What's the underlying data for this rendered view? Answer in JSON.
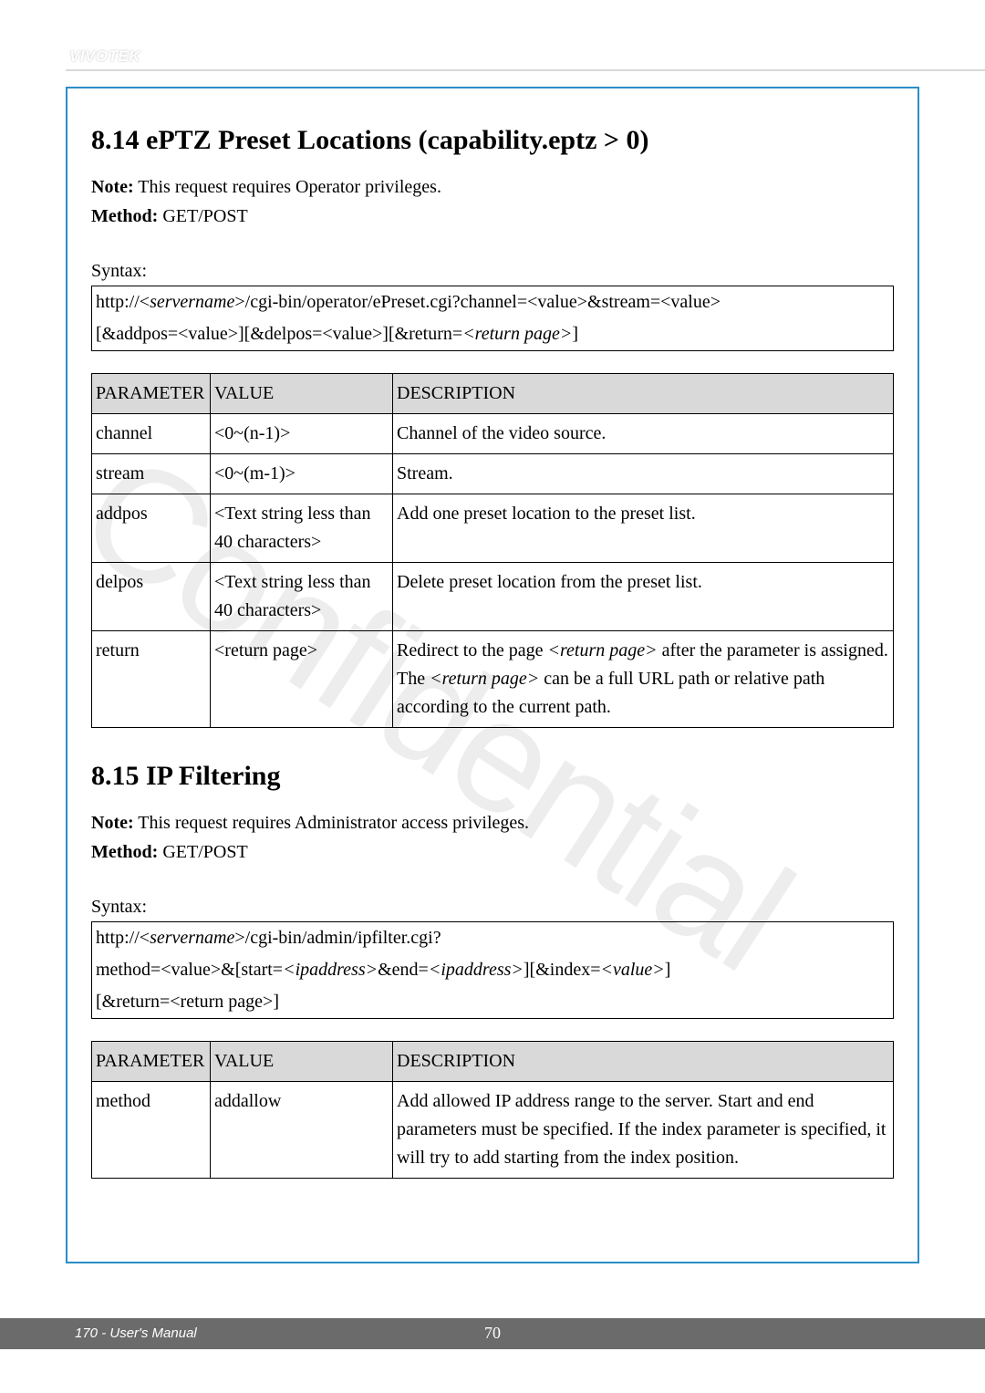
{
  "brand": "VIVOTEK",
  "watermark": "Confidential",
  "sections": {
    "s1": {
      "title": "8.14 ePTZ Preset Locations (capability.eptz > 0)",
      "note_label": "Note:",
      "note_text": " This request requires Operator privileges.",
      "method_label": "Method:",
      "method_text": " GET/POST",
      "syntax_label": "Syntax:",
      "syntax_l1_a": "http://<",
      "syntax_l1_b": "servername",
      "syntax_l1_c": ">/cgi-bin/operator/ePreset.cgi?channel=<value>&stream=<value>",
      "syntax_l2_a": "[&addpos=<value>][&delpos=<value>][&return=",
      "syntax_l2_b": "<return page>",
      "syntax_l2_c": "]",
      "headers": {
        "p": "PARAMETER",
        "v": "VALUE",
        "d": "DESCRIPTION"
      },
      "rows": [
        {
          "p": "channel",
          "v": "<0~(n-1)>",
          "d": "Channel of the video source."
        },
        {
          "p": "stream",
          "v": "<0~(m-1)>",
          "d": "Stream."
        },
        {
          "p": "addpos",
          "v": "<Text string less than 40 characters>",
          "d": "Add one preset location to the preset list."
        },
        {
          "p": "delpos",
          "v": "<Text string less than 40 characters>",
          "d": "Delete preset location from the preset list."
        },
        {
          "p": "return",
          "v": "<return page>",
          "d_a": "Redirect to the page ",
          "d_b": "<return page>",
          "d_c": " after the parameter is assigned. The ",
          "d_d": "<return page>",
          "d_e": " can be a full URL path or relative path according to the current path."
        }
      ]
    },
    "s2": {
      "title": "8.15 IP Filtering",
      "note_label": "Note:",
      "note_text": " This request requires Administrator access privileges.",
      "method_label": "Method:",
      "method_text": " GET/POST",
      "syntax_label": "Syntax:",
      "syntax_l1_a": "http://<",
      "syntax_l1_b": "servername",
      "syntax_l1_c": ">/cgi-bin/admin/ipfilter.cgi?",
      "syntax_l2_a": "method=<value>&[start=",
      "syntax_l2_b": "<ipaddress>",
      "syntax_l2_c": "&end=",
      "syntax_l2_d": "<ipaddress>",
      "syntax_l2_e": "][&index=",
      "syntax_l2_f": "<value>",
      "syntax_l2_g": "]",
      "syntax_l3": "[&return=<return page>]",
      "headers": {
        "p": "PARAMETER",
        "v": "VALUE",
        "d": "DESCRIPTION"
      },
      "rows": [
        {
          "p": "method",
          "v": "addallow",
          "d": "Add allowed IP address range to the server. Start and end parameters must be specified. If the index parameter is specified, it will try to add starting from the index position."
        }
      ]
    }
  },
  "footer": {
    "left": "170 - User's Manual",
    "center": "70"
  }
}
